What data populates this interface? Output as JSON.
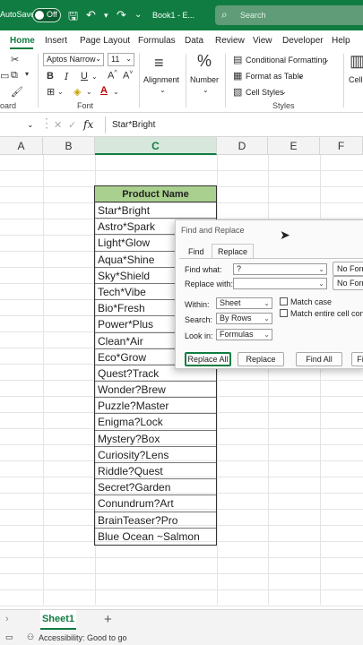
{
  "titlebar": {
    "autosave_label": "AutoSave",
    "toggle_label": "Off",
    "doc_title": "Book1 - E...",
    "search_placeholder": "Search"
  },
  "menu": [
    "Home",
    "Insert",
    "Page Layout",
    "Formulas",
    "Data",
    "Review",
    "View",
    "Developer",
    "Help"
  ],
  "ribbon": {
    "font_name": "Aptos Narrow",
    "font_size": "11",
    "clipboard_label": "oard",
    "font_group_label": "Font",
    "alignment_label": "Alignment",
    "number_label": "Number",
    "conditional_formatting": "Conditional Formatting",
    "format_as_table": "Format as Table",
    "cell_styles": "Cell Styles",
    "styles_group_label": "Styles",
    "cells_label": "Cell"
  },
  "formula_bar": {
    "fx": "fx",
    "value": "Star*Bright"
  },
  "columns": [
    "A",
    "B",
    "C",
    "D",
    "E",
    "F"
  ],
  "table": {
    "header": "Product Name",
    "rows": [
      "Star*Bright",
      "Astro*Spark",
      "Light*Glow",
      "Aqua*Shine",
      "Sky*Shield",
      "Tech*Vibe",
      "Bio*Fresh",
      "Power*Plus",
      "Clean*Air",
      "Eco*Grow",
      "Quest?Track",
      "Wonder?Brew",
      "Puzzle?Master",
      "Enigma?Lock",
      "Mystery?Box",
      "Curiosity?Lens",
      "Riddle?Quest",
      "Secret?Garden",
      "Conundrum?Art",
      "BrainTeaser?Pro",
      "Blue Ocean ~Salmon"
    ]
  },
  "dialog": {
    "title": "Find and Replace",
    "tab_find": "Find",
    "tab_replace": "Replace",
    "find_what_label": "Find what:",
    "find_what_value": "?",
    "replace_with_label": "Replace with:",
    "replace_with_value": "",
    "no_format_1": "No Form",
    "no_format_2": "No Form",
    "within_label": "Within:",
    "within_value": "Sheet",
    "search_label": "Search:",
    "search_value": "By Rows",
    "look_in_label": "Look in:",
    "look_in_value": "Formulas",
    "match_case": "Match case",
    "match_entire": "Match entire cell conte",
    "btn_replace_all": "Replace All",
    "btn_replace": "Replace",
    "btn_find_all": "Find All",
    "btn_find_next": "Fi"
  },
  "sheet_tab": "Sheet1",
  "status": "Accessibility: Good to go"
}
